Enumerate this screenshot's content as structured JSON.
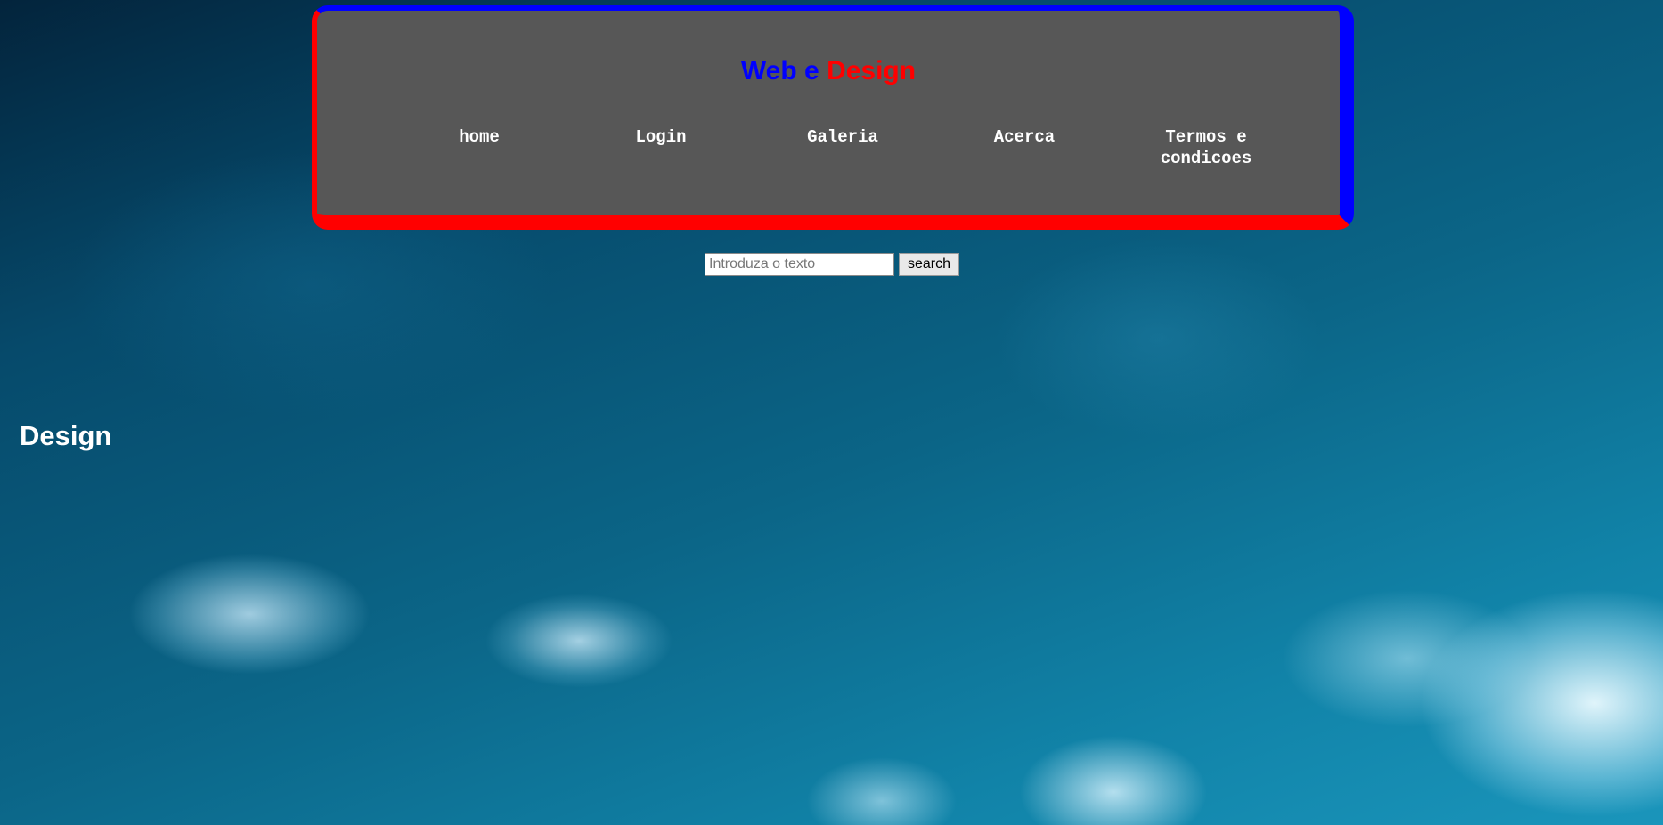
{
  "header": {
    "title_part1": "Web e",
    "title_part2": "Design",
    "nav": [
      {
        "label": "home"
      },
      {
        "label": "Login"
      },
      {
        "label": "Galeria"
      },
      {
        "label": "Acerca"
      },
      {
        "label": "Termos e condicoes"
      }
    ]
  },
  "search": {
    "placeholder": "Introduza o texto",
    "value": "",
    "button_label": "search"
  },
  "main": {
    "heading": "Design"
  },
  "colors": {
    "title_blue": "#0000ff",
    "title_red": "#ff0000",
    "header_bg": "#575757"
  }
}
